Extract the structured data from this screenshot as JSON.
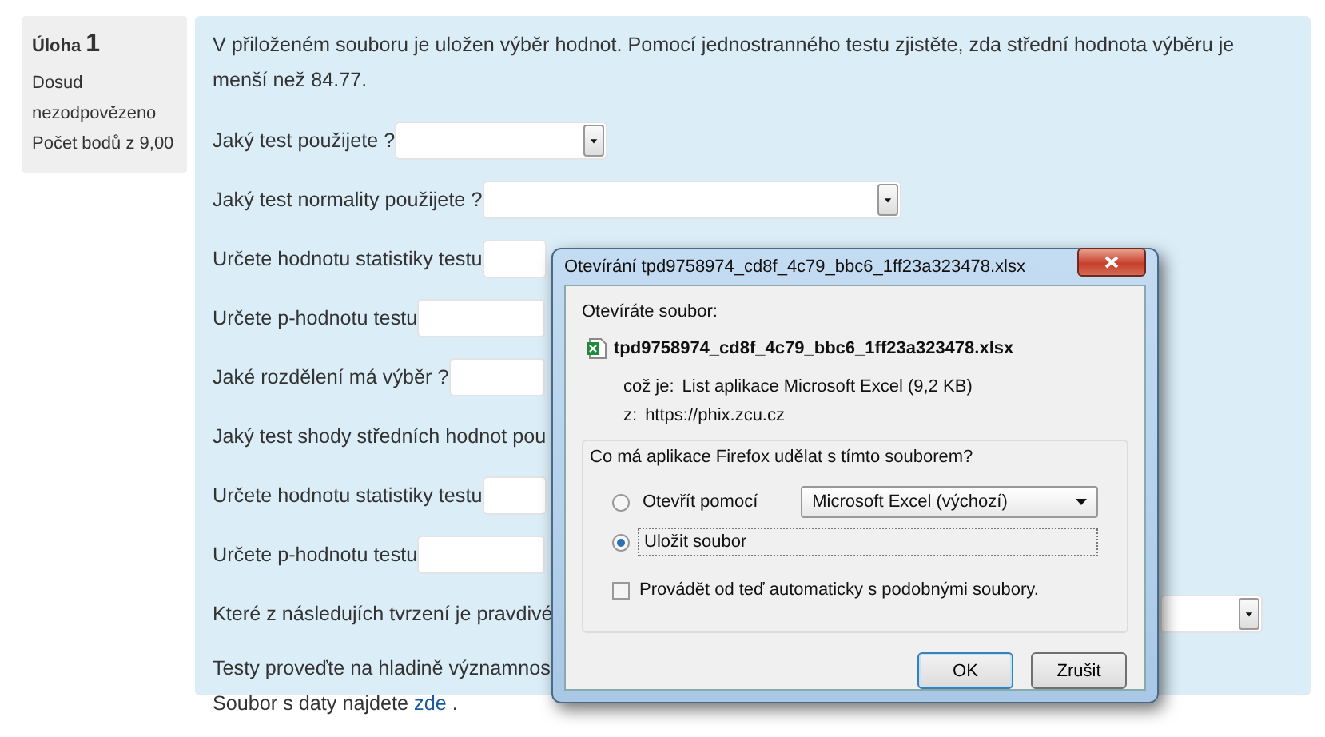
{
  "sidebar": {
    "label": "Úloha",
    "number": "1",
    "status": "Dosud nezodpovězeno",
    "points": "Počet bodů z 9,00"
  },
  "question": {
    "intro": "V přiloženém souboru je uložen výběr hodnot. Pomocí jednostranného testu zjistěte, zda střední hodnota výběru je menší než 84.77.",
    "fields": [
      {
        "label": "Jaký test použijete ?",
        "kind": "select"
      },
      {
        "label": "Jaký test normality použijete ?",
        "kind": "select"
      },
      {
        "label": "Určete hodnotu statistiky testu",
        "kind": "input"
      },
      {
        "label": "Určete p-hodnotu testu",
        "kind": "input"
      },
      {
        "label": "Jaké rozdělení má výběr ?",
        "kind": "input"
      },
      {
        "label": "Jaký test shody středních hodnot pou",
        "kind": "none"
      },
      {
        "label": "Určete hodnotu statistiky testu",
        "kind": "input"
      },
      {
        "label": "Určete p-hodnotu testu",
        "kind": "input"
      },
      {
        "label": "Které z následujích tvrzení je pravdivé",
        "kind": "select"
      }
    ],
    "note": "Testy proveďte na hladině významnos",
    "file_line": "Soubor s daty najdete",
    "link": "zde",
    "trailing": "."
  },
  "dialog": {
    "title": "Otevírání tpd9758974_cd8f_4c79_bbc6_1ff23a323478.xlsx",
    "opening_label": "Otevíráte soubor:",
    "file_name": "tpd9758974_cd8f_4c79_bbc6_1ff23a323478.xlsx",
    "type_label": "což je:",
    "type_value": "List aplikace Microsoft Excel (9,2 KB)",
    "from_label": "z:",
    "from_value": "https://phix.zcu.cz",
    "question": "Co má aplikace Firefox udělat s tímto souborem?",
    "options": [
      {
        "label": "Otevřít pomocí",
        "selected": false,
        "app": "Microsoft Excel (výchozí)"
      },
      {
        "label": "Uložit soubor",
        "selected": true
      }
    ],
    "remember": {
      "label": "Provádět od teď automaticky s podobnými soubory.",
      "checked": false
    },
    "buttons": [
      "OK",
      "Zrušit"
    ]
  }
}
